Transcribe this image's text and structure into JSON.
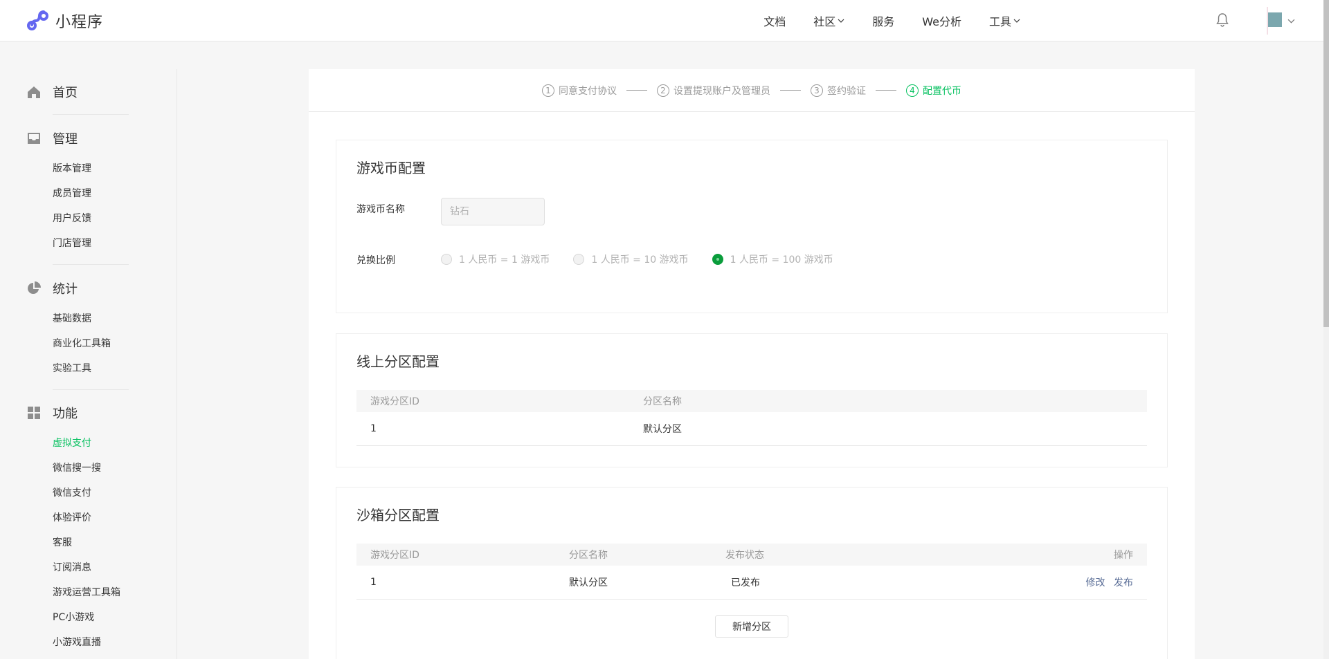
{
  "header": {
    "app_name": "小程序",
    "nav": [
      {
        "label": "文档",
        "dropdown": false
      },
      {
        "label": "社区",
        "dropdown": true
      },
      {
        "label": "服务",
        "dropdown": false
      },
      {
        "label": "We分析",
        "dropdown": false
      },
      {
        "label": "工具",
        "dropdown": true
      }
    ],
    "notification_icon": "bell-icon",
    "avatar_icon": "avatar"
  },
  "sidebar": {
    "sections": [
      {
        "title": "首页",
        "icon": "home-icon",
        "items": []
      },
      {
        "title": "管理",
        "icon": "inbox-icon",
        "items": [
          "版本管理",
          "成员管理",
          "用户反馈",
          "门店管理"
        ]
      },
      {
        "title": "统计",
        "icon": "pie-chart-icon",
        "items": [
          "基础数据",
          "商业化工具箱",
          "实验工具"
        ]
      },
      {
        "title": "功能",
        "icon": "grid-icon",
        "items": [
          "虚拟支付",
          "微信搜一搜",
          "微信支付",
          "体验评价",
          "客服",
          "订阅消息",
          "游戏运营工具箱",
          "PC小游戏",
          "小游戏直播"
        ]
      }
    ],
    "active_item": "虚拟支付"
  },
  "steps": [
    {
      "num": "1",
      "label": "同意支付协议",
      "active": false
    },
    {
      "num": "2",
      "label": "设置提现账户及管理员",
      "active": false
    },
    {
      "num": "3",
      "label": "签约验证",
      "active": false
    },
    {
      "num": "4",
      "label": "配置代币",
      "active": true
    }
  ],
  "coin_config": {
    "title": "游戏币配置",
    "name_label": "游戏币名称",
    "name_value": "钻石",
    "ratio_label": "兑换比例",
    "ratio_options": [
      "1 人民币 = 1 游戏币",
      "1 人民币 = 10 游戏币",
      "1 人民币 = 100 游戏币"
    ],
    "selected_ratio_index": 2
  },
  "online_zones": {
    "title": "线上分区配置",
    "columns": [
      "游戏分区ID",
      "分区名称"
    ],
    "rows": [
      [
        "1",
        "默认分区"
      ]
    ]
  },
  "sandbox_zones": {
    "title": "沙箱分区配置",
    "columns": [
      "游戏分区ID",
      "分区名称",
      "发布状态",
      "操作"
    ],
    "rows": [
      {
        "id": "1",
        "name": "默认分区",
        "status": "已发布",
        "actions": [
          "修改",
          "发布"
        ]
      }
    ],
    "add_button": "新增分区"
  },
  "colors": {
    "accent": "#07c160",
    "link": "#576b95",
    "radio_checked": "#0a9d3c"
  }
}
